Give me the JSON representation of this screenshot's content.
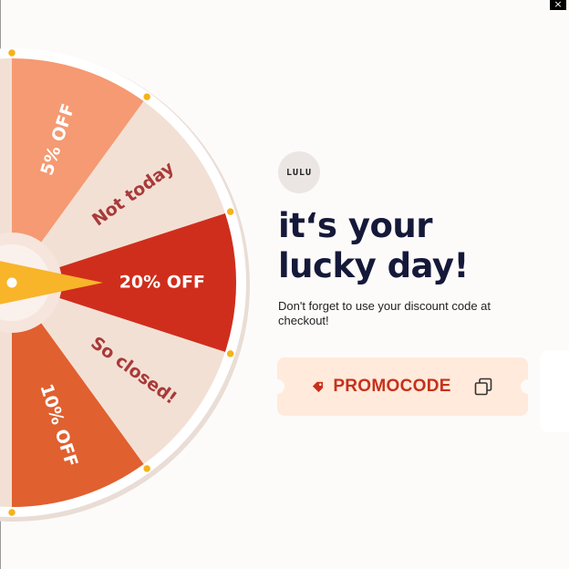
{
  "close_button": {
    "label": "×"
  },
  "wheel": {
    "segments": [
      {
        "label": "5% OFF",
        "color": "#f59a72",
        "text_color": "#ffffff"
      },
      {
        "label": "Not today",
        "color": "#f3e0d4",
        "text_color": "#a83a3a"
      },
      {
        "label": "20% OFF",
        "color": "#cf2e1c",
        "text_color": "#ffffff"
      },
      {
        "label": "So closed!",
        "color": "#f3e0d4",
        "text_color": "#a83a3a"
      },
      {
        "label": "10% OFF",
        "color": "#e0602f",
        "text_color": "#ffffff"
      }
    ],
    "rim_color": "#ffffff",
    "peg_color": "#f5b21a",
    "pointer_color": "#f8b52a"
  },
  "brand": {
    "logo_text": "LULU"
  },
  "headline": "it‘s your lucky day!",
  "subtext": "Don't forget to use your discount code at checkout!",
  "promo": {
    "code": "PROMOCODE",
    "tag_icon": "tag-icon",
    "copy_icon": "copy-icon"
  },
  "colors": {
    "accent": "#c7311b",
    "headline": "#151939",
    "promo_bg": "#ffeadb"
  }
}
